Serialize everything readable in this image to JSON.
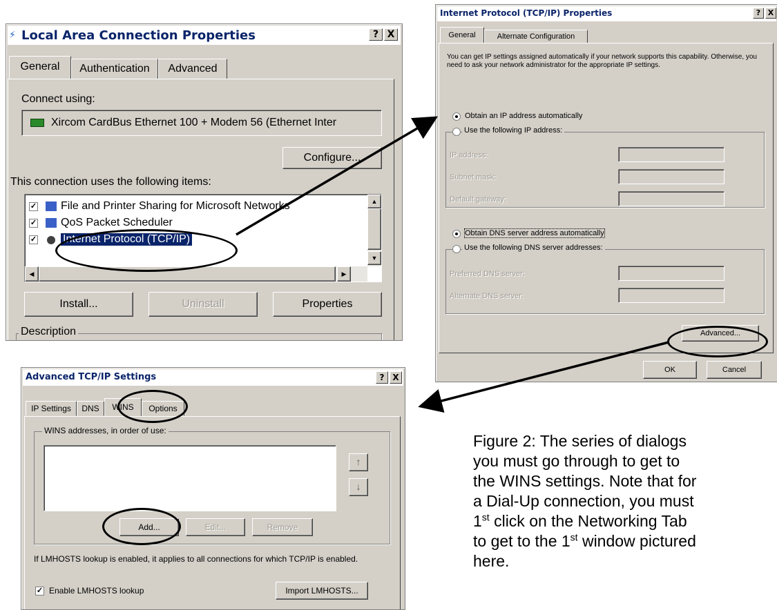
{
  "lac": {
    "title": "Local Area Connection Properties",
    "help": "?",
    "close": "X",
    "tabs": [
      "General",
      "Authentication",
      "Advanced"
    ],
    "connect_using_label": "Connect using:",
    "adapter": "Xircom CardBus Ethernet 100 + Modem 56 (Ethernet Inter",
    "configure": "Configure...",
    "items_label": "This connection uses the following items:",
    "items": [
      {
        "label": "File and Printer Sharing for Microsoft Networks",
        "checked": true
      },
      {
        "label": "QoS Packet Scheduler",
        "checked": true
      },
      {
        "label": "Internet Protocol (TCP/IP)",
        "checked": true,
        "selected": true
      }
    ],
    "install": "Install...",
    "uninstall": "Uninstall",
    "properties": "Properties",
    "description_label": "Description"
  },
  "tcpip": {
    "title": "Internet Protocol (TCP/IP) Properties",
    "help": "?",
    "close": "X",
    "tabs": [
      "General",
      "Alternate Configuration"
    ],
    "intro": "You can get IP settings assigned automatically if your network supports this capability. Otherwise, you need to ask your network administrator for the appropriate IP settings.",
    "obtain_ip": "Obtain an IP address automatically",
    "use_ip": "Use the following IP address:",
    "ip_address": "IP address:",
    "subnet_mask": "Subnet mask:",
    "default_gateway": "Default gateway:",
    "obtain_dns": "Obtain DNS server address automatically",
    "use_dns": "Use the following DNS server addresses:",
    "preferred_dns": "Preferred DNS server:",
    "alternate_dns": "Alternate DNS server:",
    "advanced": "Advanced...",
    "ok": "OK",
    "cancel": "Cancel"
  },
  "adv": {
    "title": "Advanced TCP/IP Settings",
    "help": "?",
    "close": "X",
    "tabs": [
      "IP Settings",
      "DNS",
      "WINS",
      "Options"
    ],
    "wins_group": "WINS addresses, in order of use:",
    "up_arrow": "↑",
    "down_arrow": "↓",
    "add": "Add...",
    "edit": "Edit...",
    "remove": "Remove",
    "lmhosts_note": "If LMHOSTS lookup is enabled, it applies to all connections for which TCP/IP is enabled.",
    "enable_lmhosts": "Enable LMHOSTS lookup",
    "import_lmhosts": "Import LMHOSTS..."
  },
  "caption": {
    "lines": [
      "Figure 2: The series of dialogs",
      "you must go through to get to",
      "the WINS settings. Note that for",
      "a Dial-Up connection, you must"
    ],
    "line5_pre": "1",
    "line5_sup": "st",
    "line5_post": " click on the Networking Tab",
    "line6_pre": "to get to the 1",
    "line6_sup": "st",
    "line6_post": " window pictured",
    "line7": "here."
  }
}
